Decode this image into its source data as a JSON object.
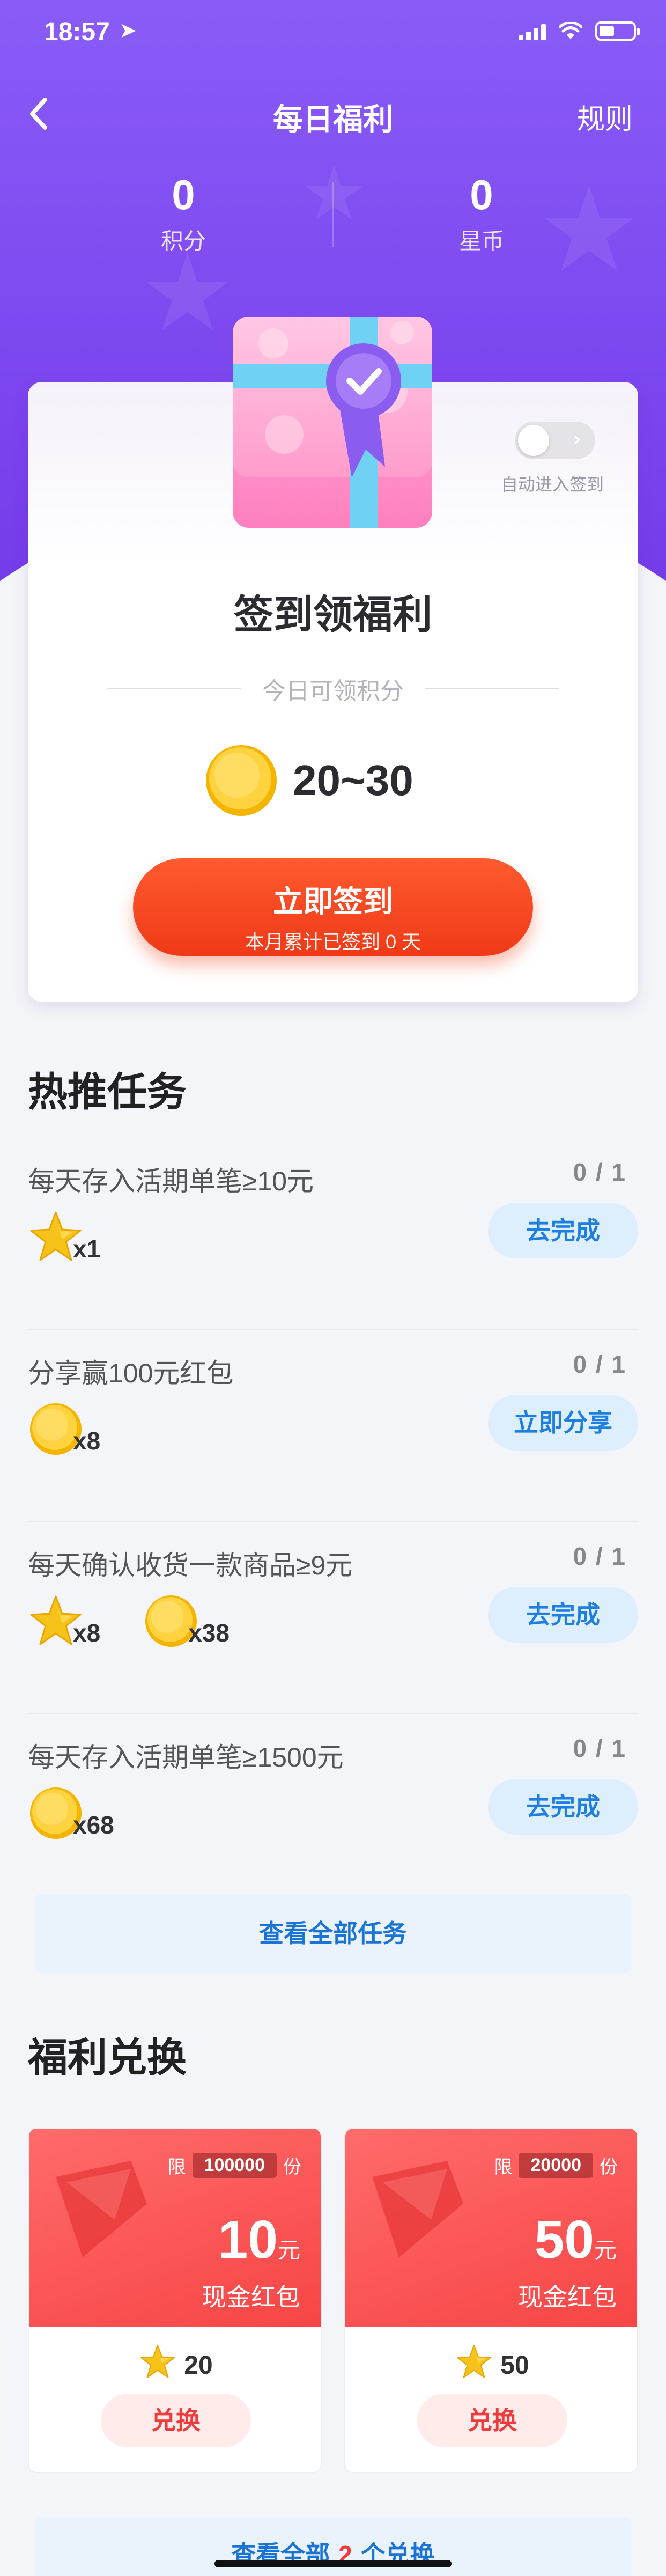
{
  "status_bar": {
    "time": "18:57",
    "battery_level": 0.45
  },
  "nav": {
    "title": "每日福利",
    "rules": "规则"
  },
  "stats": [
    {
      "value": "0",
      "label": "积分"
    },
    {
      "value": "0",
      "label": "星币"
    }
  ],
  "checkin": {
    "auto_label": "自动进入签到",
    "title": "签到领福利",
    "subtitle": "今日可领积分",
    "points_range": "20~30",
    "button_main": "立即签到",
    "button_sub": "本月累计已签到 0 天"
  },
  "tasks_section": {
    "title": "热推任务",
    "tasks": [
      {
        "name": "每天存入活期单笔≥10元",
        "progress": "0 / 1",
        "button": "去完成",
        "rewards": [
          {
            "type": "star-icon",
            "count": "x1"
          }
        ]
      },
      {
        "name": "分享赢100元红包",
        "progress": "0 / 1",
        "button": "立即分享",
        "rewards": [
          {
            "type": "coin-icon",
            "count": "x8"
          }
        ]
      },
      {
        "name": "每天确认收货一款商品≥9元",
        "progress": "0 / 1",
        "button": "去完成",
        "rewards": [
          {
            "type": "star-icon",
            "count": "x8"
          },
          {
            "type": "coin-icon",
            "count": "x38"
          }
        ]
      },
      {
        "name": "每天存入活期单笔≥1500元",
        "progress": "0 / 1",
        "button": "去完成",
        "rewards": [
          {
            "type": "coin-icon",
            "count": "x68"
          }
        ]
      }
    ],
    "view_all": "查看全部任务"
  },
  "redeem_section": {
    "title": "福利兑换",
    "cards": [
      {
        "limit_prefix": "限",
        "limit": "100000",
        "limit_suffix": "份",
        "amount": "10",
        "unit": "元",
        "type": "现金红包",
        "cost": "20",
        "button": "兑换"
      },
      {
        "limit_prefix": "限",
        "limit": "20000",
        "limit_suffix": "份",
        "amount": "50",
        "unit": "元",
        "type": "现金红包",
        "cost": "50",
        "button": "兑换"
      }
    ],
    "view_all_prefix": "查看全部",
    "view_all_count": "2",
    "view_all_suffix": "个兑换"
  },
  "colors": {
    "hero_purple": "#7c45ee",
    "checkin_red": "#f03a17",
    "task_blue": "#1f7fe0",
    "redeem_red": "#f84545"
  }
}
